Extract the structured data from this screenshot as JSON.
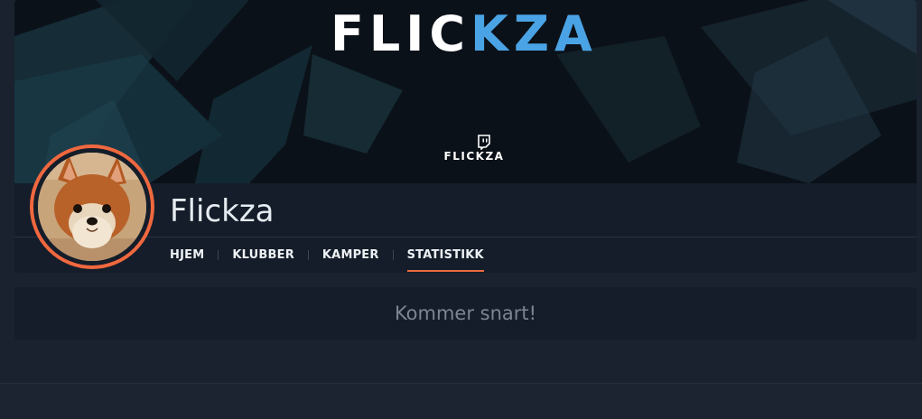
{
  "banner": {
    "title_part1": "FLIC",
    "title_part2": "KZA",
    "brand_label": "FLICKZA"
  },
  "profile": {
    "name": "Flickza"
  },
  "tabs": [
    {
      "label": "HJEM",
      "active": false
    },
    {
      "label": "KLUBBER",
      "active": false
    },
    {
      "label": "KAMPER",
      "active": false
    },
    {
      "label": "STATISTIKK",
      "active": true
    }
  ],
  "content": {
    "message": "Kommer snart!"
  },
  "colors": {
    "accent": "#f0683f",
    "brand_blue": "#4aa3e4",
    "background": "#19222e",
    "card": "#141d29"
  },
  "icons": {
    "banner_icon": "twitch-icon"
  }
}
